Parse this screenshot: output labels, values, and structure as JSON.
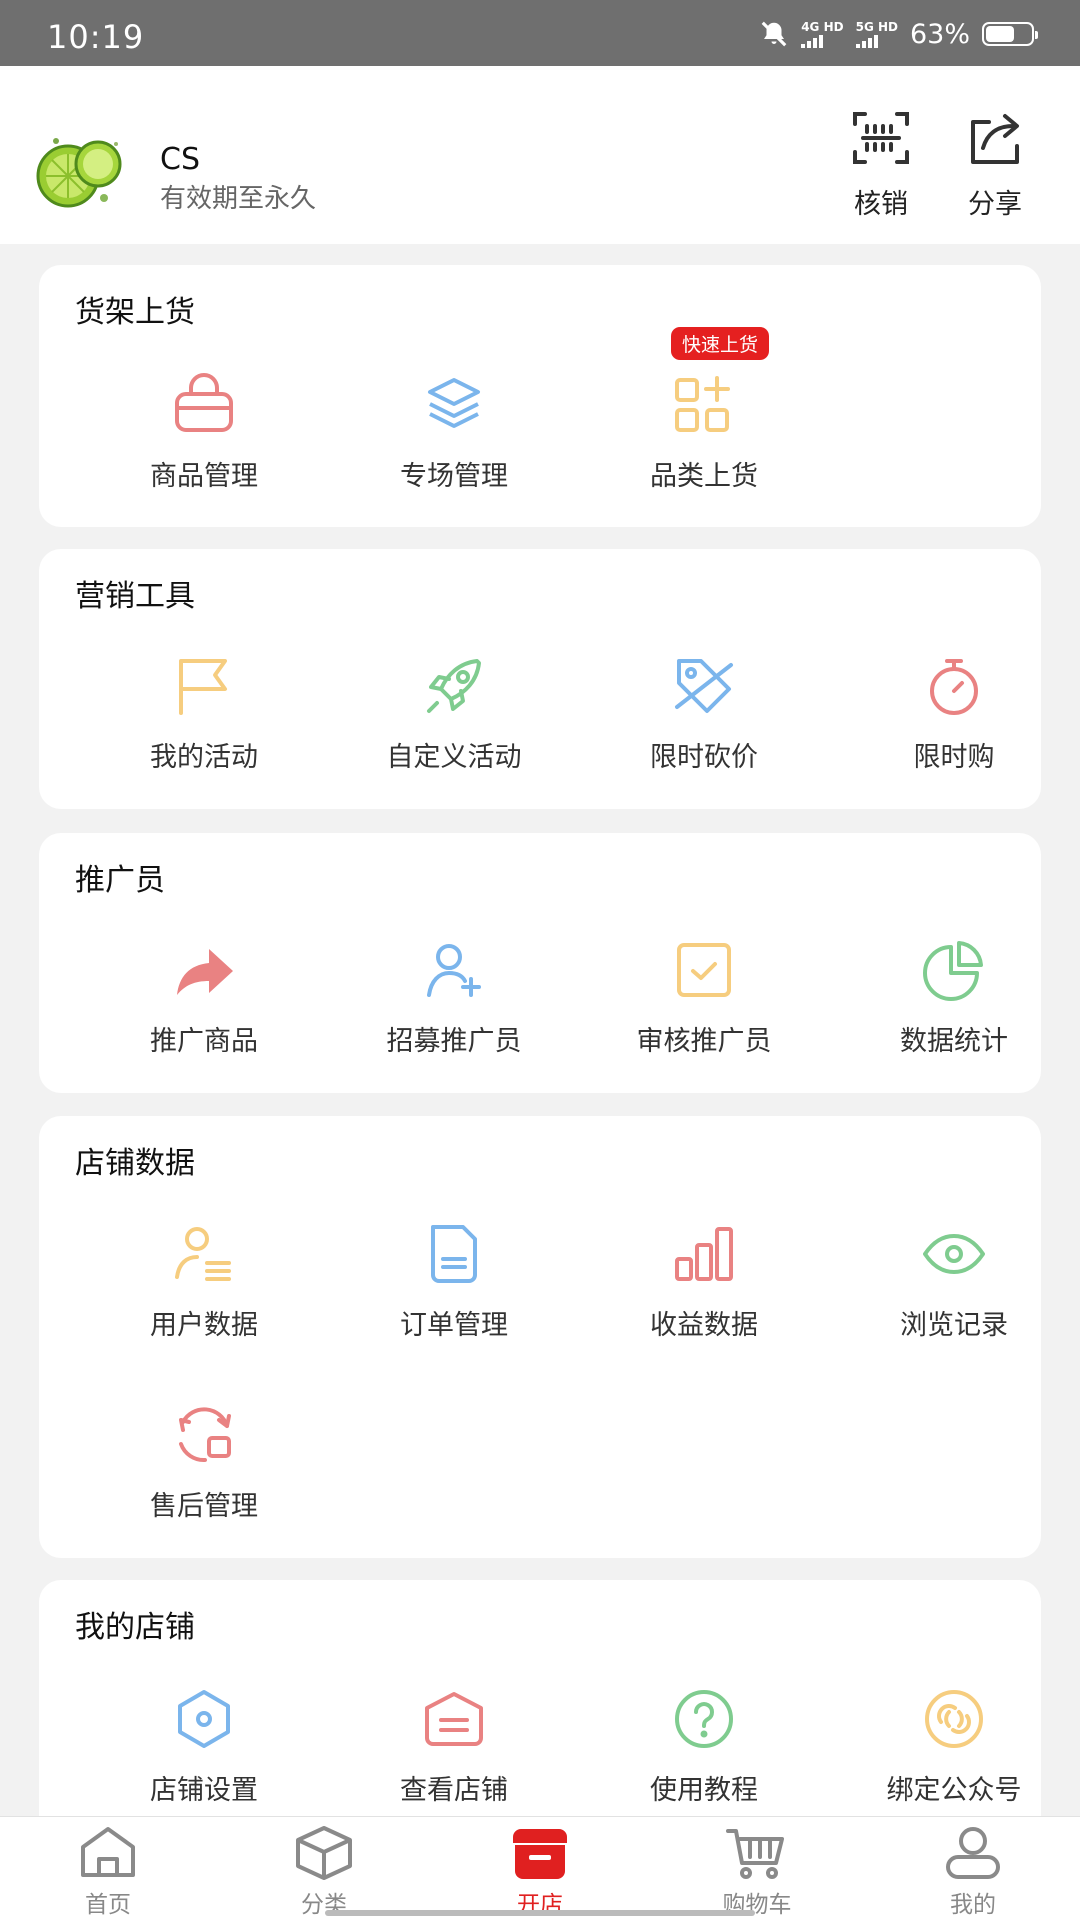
{
  "status": {
    "time": "10:19",
    "net1": "4G HD",
    "net2": "5G HD",
    "battery": "63%",
    "battery_level": 0.63
  },
  "header": {
    "store_name": "CS",
    "validity": "有效期至永久",
    "verify_label": "核销",
    "share_label": "分享"
  },
  "sections": [
    {
      "title": "货架上货",
      "items": [
        {
          "label": "商品管理",
          "icon": "shopping-bag-icon"
        },
        {
          "label": "专场管理",
          "icon": "layers-icon"
        },
        {
          "label": "品类上货",
          "icon": "category-grid-icon",
          "badge": "快速上货"
        }
      ]
    },
    {
      "title": "营销工具",
      "items": [
        {
          "label": "我的活动",
          "icon": "flag-icon"
        },
        {
          "label": "自定义活动",
          "icon": "rocket-icon"
        },
        {
          "label": "限时砍价",
          "icon": "price-tag-slash-icon"
        },
        {
          "label": "限时购",
          "icon": "stopwatch-icon"
        }
      ]
    },
    {
      "title": "推广员",
      "items": [
        {
          "label": "推广商品",
          "icon": "share-arrow-icon"
        },
        {
          "label": "招募推广员",
          "icon": "add-user-icon"
        },
        {
          "label": "审核推广员",
          "icon": "checkbox-icon"
        },
        {
          "label": "数据统计",
          "icon": "pie-chart-icon"
        }
      ]
    },
    {
      "title": "店铺数据",
      "items": [
        {
          "label": "用户数据",
          "icon": "user-list-icon"
        },
        {
          "label": "订单管理",
          "icon": "document-icon"
        },
        {
          "label": "收益数据",
          "icon": "bar-chart-icon"
        },
        {
          "label": "浏览记录",
          "icon": "eye-icon"
        },
        {
          "label": "售后管理",
          "icon": "refresh-return-icon"
        }
      ]
    },
    {
      "title": "我的店铺",
      "items": [
        {
          "label": "店铺设置",
          "icon": "hexagon-settings-icon"
        },
        {
          "label": "查看店铺",
          "icon": "store-box-icon"
        },
        {
          "label": "使用教程",
          "icon": "help-circle-icon"
        },
        {
          "label": "绑定公众号",
          "icon": "link-rings-icon"
        }
      ]
    }
  ],
  "tabs": [
    {
      "label": "首页",
      "icon": "home-icon"
    },
    {
      "label": "分类",
      "icon": "cube-icon"
    },
    {
      "label": "开店",
      "icon": "open-store-icon",
      "active": true
    },
    {
      "label": "购物车",
      "icon": "cart-icon"
    },
    {
      "label": "我的",
      "icon": "person-icon"
    }
  ],
  "colors": {
    "red": "#e98282",
    "blue": "#7bb5ec",
    "yellow": "#f6cd7f",
    "green": "#7fcc8f",
    "active": "#e02020",
    "tab_inactive": "#8a8a8a"
  }
}
